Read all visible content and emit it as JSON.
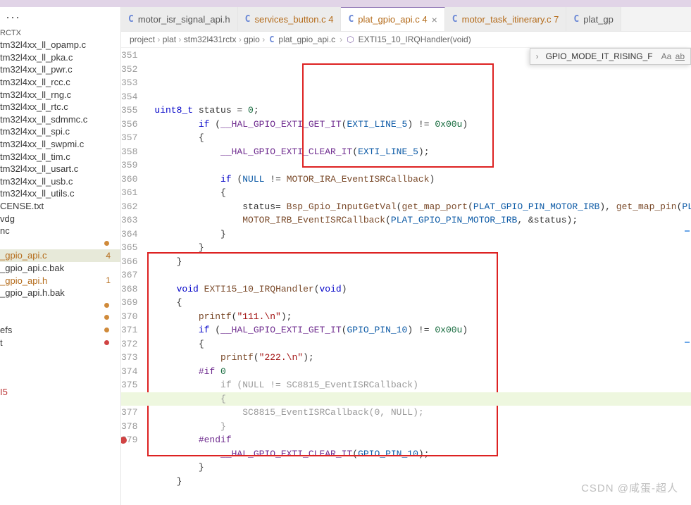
{
  "sidebar": {
    "section": "RCTX",
    "ellipsis": "···",
    "items": [
      {
        "label": "tm32l4xx_ll_opamp.c"
      },
      {
        "label": "tm32l4xx_ll_pka.c"
      },
      {
        "label": "tm32l4xx_ll_pwr.c"
      },
      {
        "label": "tm32l4xx_ll_rcc.c"
      },
      {
        "label": "tm32l4xx_ll_rng.c"
      },
      {
        "label": "tm32l4xx_ll_rtc.c"
      },
      {
        "label": "tm32l4xx_ll_sdmmc.c"
      },
      {
        "label": "tm32l4xx_ll_spi.c"
      },
      {
        "label": "tm32l4xx_ll_swpmi.c"
      },
      {
        "label": "tm32l4xx_ll_tim.c"
      },
      {
        "label": "tm32l4xx_ll_usart.c"
      },
      {
        "label": "tm32l4xx_ll_usb.c"
      },
      {
        "label": "tm32l4xx_ll_utils.c"
      },
      {
        "label": "CENSE.txt"
      },
      {
        "label": "vdg"
      },
      {
        "label": "nc"
      },
      {
        "label": "",
        "dot": "orange"
      },
      {
        "label": "_gpio_api.c",
        "modified": true,
        "badge": "4",
        "active": true
      },
      {
        "label": "_gpio_api.c.bak"
      },
      {
        "label": "_gpio_api.h",
        "modified": true,
        "badge": "1"
      },
      {
        "label": "_gpio_api.h.bak"
      },
      {
        "label": "",
        "dot": "orange"
      },
      {
        "label": "",
        "dot": "orange"
      },
      {
        "label": "efs",
        "dot": "orange"
      },
      {
        "label": "t",
        "dot": "red"
      },
      {
        "label": ""
      },
      {
        "label": ""
      },
      {
        "label": ""
      },
      {
        "label": "I5",
        "truncated": true
      }
    ]
  },
  "tabs": [
    {
      "icon": "C",
      "name": "motor_isr_signal_api.h"
    },
    {
      "icon": "C",
      "name": "services_button.c",
      "mod": "4"
    },
    {
      "icon": "C",
      "name": "plat_gpio_api.c",
      "mod": "4",
      "active": true,
      "close": true
    },
    {
      "icon": "C",
      "name": "motor_task_itinerary.c",
      "mod": "7"
    },
    {
      "icon": "C",
      "name": "plat_gp"
    }
  ],
  "breadcrumb": {
    "parts": [
      "project",
      "plat",
      "stm32l431rctx",
      "gpio"
    ],
    "file": "plat_gpio_api.c",
    "symbol": "EXTI15_10_IRQHandler(void)"
  },
  "search": {
    "value": "GPIO_MODE_IT_RISING_F",
    "opt_case": "Aa",
    "opt_word": "ab"
  },
  "code": {
    "start": 351,
    "highlight": 372,
    "breakpoint": 379,
    "lines": [
      {
        "n": 351,
        "t": "        uint8_t status = 0;",
        "seg": [
          [
            "kw",
            "uint8_t"
          ],
          [
            "",
            " "
          ],
          [
            "",
            "status "
          ],
          [
            "",
            "= "
          ],
          [
            "num",
            "0"
          ],
          [
            "",
            ";"
          ]
        ]
      },
      {
        "n": 352,
        "seg": [
          [
            "",
            "        "
          ],
          [
            "kw",
            "if"
          ],
          [
            "",
            " ("
          ],
          [
            "mac",
            "__HAL_GPIO_EXTI_GET_IT"
          ],
          [
            "",
            "("
          ],
          [
            "const-v",
            "EXTI_LINE_5"
          ],
          [
            "",
            ") != "
          ],
          [
            "num",
            "0x00u"
          ],
          [
            "",
            ")"
          ]
        ]
      },
      {
        "n": 353,
        "seg": [
          [
            "",
            "        {"
          ]
        ]
      },
      {
        "n": 354,
        "seg": [
          [
            "",
            "            "
          ],
          [
            "mac",
            "__HAL_GPIO_EXTI_CLEAR_IT"
          ],
          [
            "",
            "("
          ],
          [
            "const-v",
            "EXTI_LINE_5"
          ],
          [
            "",
            ");"
          ]
        ]
      },
      {
        "n": 355,
        "seg": [
          [
            "",
            ""
          ]
        ]
      },
      {
        "n": 356,
        "seg": [
          [
            "",
            "            "
          ],
          [
            "kw",
            "if"
          ],
          [
            "",
            " ("
          ],
          [
            "const-v",
            "NULL"
          ],
          [
            "",
            " != "
          ],
          [
            "fn",
            "MOTOR_IRA_EventISRCallback"
          ],
          [
            "",
            ")"
          ]
        ]
      },
      {
        "n": 357,
        "seg": [
          [
            "",
            "            {"
          ]
        ]
      },
      {
        "n": 358,
        "seg": [
          [
            "",
            "                status= "
          ],
          [
            "fn",
            "Bsp_Gpio_InputGetVal"
          ],
          [
            "",
            "("
          ],
          [
            "fn",
            "get_map_port"
          ],
          [
            "",
            "("
          ],
          [
            "const-v",
            "PLAT_GPIO_PIN_MOTOR_IRB"
          ],
          [
            "",
            "), "
          ],
          [
            "fn",
            "get_map_pin"
          ],
          [
            "",
            "("
          ],
          [
            "const-v",
            "PLAT_"
          ]
        ]
      },
      {
        "n": 359,
        "seg": [
          [
            "",
            "                "
          ],
          [
            "fn",
            "MOTOR_IRB_EventISRCallback"
          ],
          [
            "",
            "("
          ],
          [
            "const-v",
            "PLAT_GPIO_PIN_MOTOR_IRB"
          ],
          [
            "",
            ", &status);"
          ]
        ]
      },
      {
        "n": 360,
        "seg": [
          [
            "",
            "            }"
          ]
        ]
      },
      {
        "n": 361,
        "seg": [
          [
            "",
            "        }"
          ]
        ]
      },
      {
        "n": 362,
        "seg": [
          [
            "",
            "    }"
          ]
        ]
      },
      {
        "n": 363,
        "seg": [
          [
            "",
            ""
          ]
        ]
      },
      {
        "n": 364,
        "seg": [
          [
            "",
            "    "
          ],
          [
            "kw",
            "void"
          ],
          [
            "",
            " "
          ],
          [
            "fn",
            "EXTI15_10_IRQHandler"
          ],
          [
            "",
            "("
          ],
          [
            "kw",
            "void"
          ],
          [
            "",
            ")"
          ]
        ]
      },
      {
        "n": 365,
        "seg": [
          [
            "",
            "    {"
          ]
        ]
      },
      {
        "n": 366,
        "seg": [
          [
            "",
            "        "
          ],
          [
            "fn",
            "printf"
          ],
          [
            "",
            "("
          ],
          [
            "str",
            "\"111.\\n\""
          ],
          [
            "",
            ");"
          ]
        ]
      },
      {
        "n": 367,
        "seg": [
          [
            "",
            "        "
          ],
          [
            "kw",
            "if"
          ],
          [
            "",
            " ("
          ],
          [
            "mac",
            "__HAL_GPIO_EXTI_GET_IT"
          ],
          [
            "",
            "("
          ],
          [
            "const-v",
            "GPIO_PIN_10"
          ],
          [
            "",
            ") != "
          ],
          [
            "num",
            "0x00u"
          ],
          [
            "",
            ")"
          ]
        ]
      },
      {
        "n": 368,
        "seg": [
          [
            "",
            "        {"
          ]
        ]
      },
      {
        "n": 369,
        "seg": [
          [
            "",
            "            "
          ],
          [
            "fn",
            "printf"
          ],
          [
            "",
            "("
          ],
          [
            "str",
            "\"222.\\n\""
          ],
          [
            "",
            ");"
          ]
        ]
      },
      {
        "n": 370,
        "seg": [
          [
            "",
            "        "
          ],
          [
            "mac",
            "#if"
          ],
          [
            "",
            " "
          ],
          [
            "num",
            "0"
          ]
        ]
      },
      {
        "n": 371,
        "seg": [
          [
            "cmt",
            "            if (NULL != SC8815_EventISRCallback)"
          ]
        ]
      },
      {
        "n": 372,
        "seg": [
          [
            "cmt",
            "            {"
          ]
        ],
        "hl": true
      },
      {
        "n": 373,
        "seg": [
          [
            "cmt",
            "                SC8815_EventISRCallback(0, NULL);"
          ]
        ]
      },
      {
        "n": 374,
        "seg": [
          [
            "cmt",
            "            }"
          ]
        ]
      },
      {
        "n": 375,
        "seg": [
          [
            "",
            "        "
          ],
          [
            "mac",
            "#endif"
          ]
        ]
      },
      {
        "n": 376,
        "seg": [
          [
            "",
            "            "
          ],
          [
            "mac",
            "__HAL_GPIO_EXTI_CLEAR_IT"
          ],
          [
            "",
            "("
          ],
          [
            "const-v",
            "GPIO_PIN_10"
          ],
          [
            "",
            ");"
          ]
        ]
      },
      {
        "n": 377,
        "seg": [
          [
            "",
            "        }"
          ]
        ]
      },
      {
        "n": 378,
        "seg": [
          [
            "",
            "    }"
          ]
        ]
      },
      {
        "n": 379,
        "seg": [
          [
            "",
            ""
          ]
        ],
        "bp": true
      }
    ]
  },
  "watermark": "CSDN @咸蛋-超人"
}
